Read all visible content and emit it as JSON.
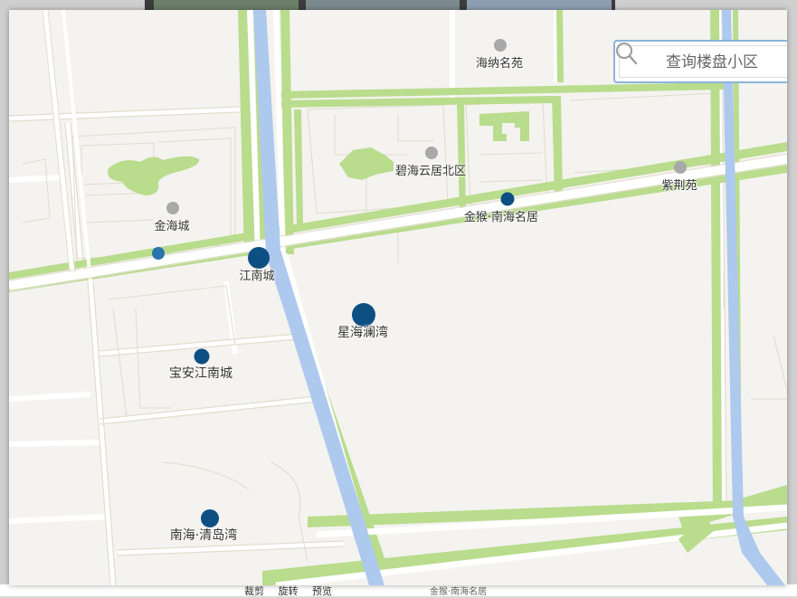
{
  "search": {
    "placeholder": "查询楼盘小区"
  },
  "background": {
    "toolbar": {
      "crop": "裁剪",
      "rotate": "旋转",
      "preview": "预览"
    },
    "caption": "金猴·南海名居"
  },
  "colors": {
    "map_bg": "#f4f3ef",
    "green_strip": "#b9dc8d",
    "water": "#aec9ee",
    "road": "#ffffff",
    "marker_blue": "#0e4f83",
    "marker_gray": "#a8a8a8"
  },
  "places": [
    {
      "id": "hainamingyuan",
      "name": "海纳名苑",
      "marker": "gray"
    },
    {
      "id": "bihaiyunju",
      "name": "碧海云居北区",
      "marker": "gray"
    },
    {
      "id": "zijingyuan",
      "name": "紫荆苑",
      "marker": "gray"
    },
    {
      "id": "jinhaicheng",
      "name": "金海城",
      "marker": "gray"
    },
    {
      "id": "jinhounanhai",
      "name": "金猴·南海名居",
      "marker": "blue"
    },
    {
      "id": "jiangnancheng",
      "name": "江南城",
      "marker": "blue"
    },
    {
      "id": "xinghailanwan",
      "name": "星海澜湾",
      "marker": "blue"
    },
    {
      "id": "baoanjiangnan",
      "name": "宝安江南城",
      "marker": "blue"
    },
    {
      "id": "nanhaiqingdaowan",
      "name": "南海·清岛湾",
      "marker": "blue"
    },
    {
      "id": "unnamed",
      "name": "",
      "marker": "light"
    }
  ]
}
